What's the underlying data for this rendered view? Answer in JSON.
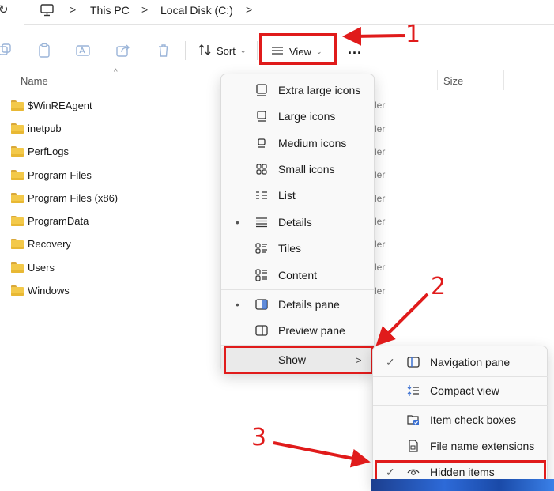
{
  "address": {
    "crumbs": [
      "This PC",
      "Local Disk (C:)"
    ],
    "separator": ">"
  },
  "toolbar": {
    "sort_label": "Sort",
    "view_label": "View",
    "more_label": "..."
  },
  "columns": {
    "name": "Name",
    "size": "Size"
  },
  "files": [
    {
      "name": "$WinREAgent",
      "type_partial": "der"
    },
    {
      "name": "inetpub",
      "type_partial": "der"
    },
    {
      "name": "PerfLogs",
      "type_partial": "der"
    },
    {
      "name": "Program Files",
      "type_partial": "der"
    },
    {
      "name": "Program Files (x86)",
      "type_partial": "der"
    },
    {
      "name": "ProgramData",
      "type_partial": "der"
    },
    {
      "name": "Recovery",
      "type_partial": "der"
    },
    {
      "name": "Users",
      "type_partial": "der"
    },
    {
      "name": "Windows",
      "type_partial": "der"
    }
  ],
  "view_menu": {
    "items": [
      {
        "label": "Extra large icons",
        "icon": "extra-large-icons-icon",
        "selected": false
      },
      {
        "label": "Large icons",
        "icon": "large-icons-icon",
        "selected": false
      },
      {
        "label": "Medium icons",
        "icon": "medium-icons-icon",
        "selected": false
      },
      {
        "label": "Small icons",
        "icon": "small-icons-icon",
        "selected": false
      },
      {
        "label": "List",
        "icon": "list-icon",
        "selected": false
      },
      {
        "label": "Details",
        "icon": "details-icon",
        "selected": true
      },
      {
        "label": "Tiles",
        "icon": "tiles-icon",
        "selected": false
      },
      {
        "label": "Content",
        "icon": "content-icon",
        "selected": false
      }
    ],
    "panes": [
      {
        "label": "Details pane",
        "icon": "details-pane-icon",
        "selected": true
      },
      {
        "label": "Preview pane",
        "icon": "preview-pane-icon",
        "selected": false
      }
    ],
    "show_label": "Show",
    "show_chevron": ">"
  },
  "show_menu": {
    "items": [
      {
        "label": "Navigation pane",
        "icon": "navigation-pane-icon",
        "checked": true
      },
      {
        "label": "Compact view",
        "icon": "compact-view-icon",
        "checked": false
      },
      {
        "label": "Item check boxes",
        "icon": "item-check-boxes-icon",
        "checked": false
      },
      {
        "label": "File name extensions",
        "icon": "file-name-extensions-icon",
        "checked": false
      },
      {
        "label": "Hidden items",
        "icon": "hidden-items-icon",
        "checked": true
      }
    ],
    "check_glyph": "✓"
  },
  "annotations": [
    "1",
    "2",
    "3"
  ],
  "colors": {
    "annotation_red": "#e01b1b",
    "menu_bg": "#f9f9f9",
    "folder_yellow": "#f3c94a"
  }
}
